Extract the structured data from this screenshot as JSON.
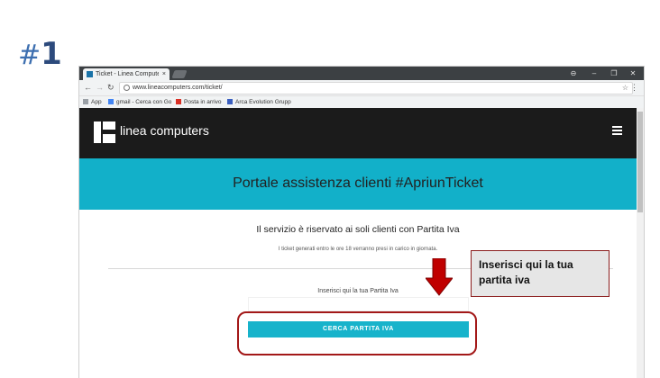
{
  "step": {
    "hash": "#",
    "number": "1"
  },
  "browser": {
    "tab_title": "Ticket - Linea Computers",
    "tab_close": "×",
    "url": "www.lineacomputers.com/ticket/",
    "bookmarks": [
      {
        "label": "App"
      },
      {
        "label": "gmail - Cerca con Go"
      },
      {
        "label": "Posta in arrivo"
      },
      {
        "label": "Arca Evolution Grupp"
      }
    ]
  },
  "site": {
    "logo_text": "linea computers",
    "hero_title": "Portale assistenza clienti  #ApriunTicket",
    "main_title": "Il servizio è riservato ai soli clienti con Partita Iva",
    "sub_note": "I ticket generati entro le ore 18 verranno presi in carico in giornata.",
    "field_label": "Inserisci qui la tua Partita Iva",
    "field_value": "",
    "search_button": "CERCA PARTITA IVA"
  },
  "annotation": {
    "callout_text": "Inserisci qui la tua partita iva",
    "arrow_color": "#c00000",
    "ring_color": "#a31818"
  },
  "colors": {
    "accent": "#12b0c9",
    "header_bg": "#1b1b1b"
  }
}
